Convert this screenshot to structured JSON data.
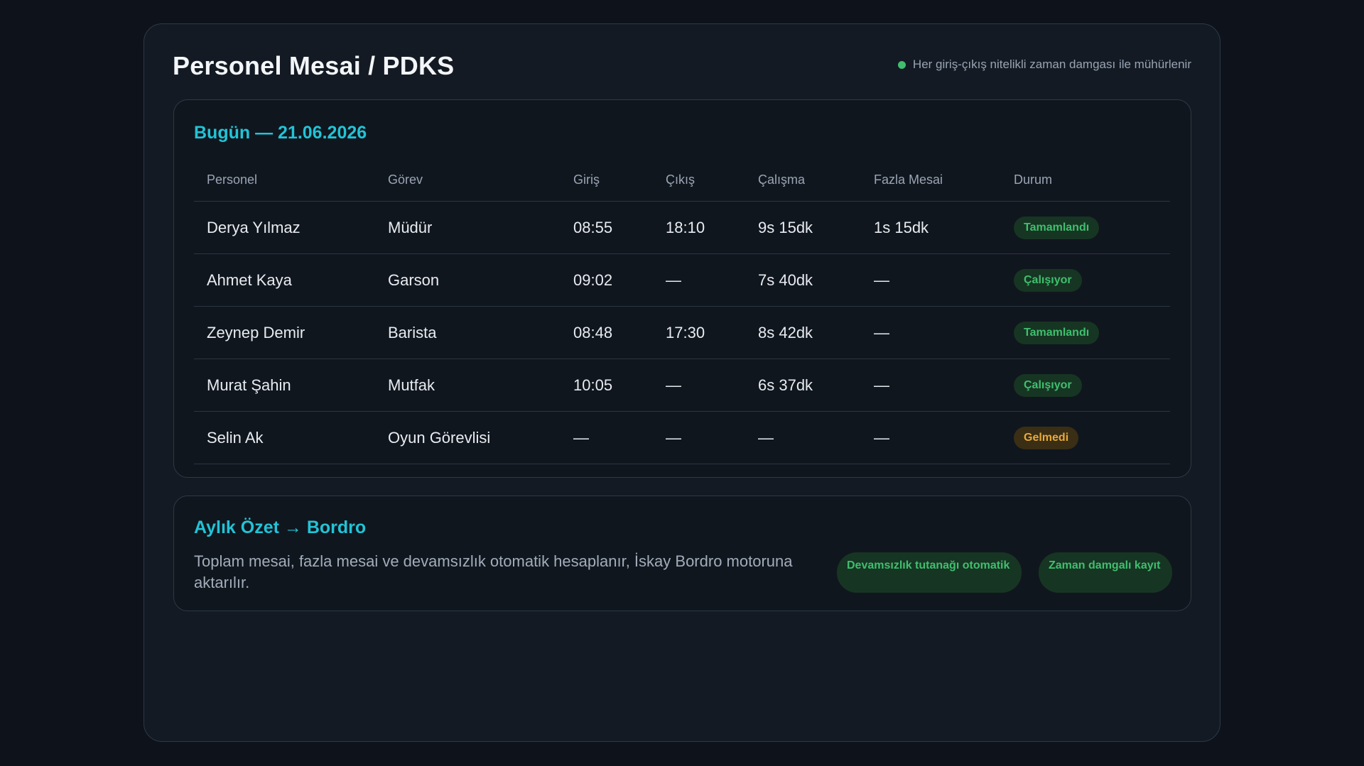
{
  "header": {
    "title": "Personel Mesai / PDKS",
    "seal_note": "Her giriş-çıkış nitelikli zaman damgası ile mühürlenir"
  },
  "today": {
    "title": "Bugün — 21.06.2026",
    "columns": [
      "Personel",
      "Görev",
      "Giriş",
      "Çıkış",
      "Çalışma",
      "Fazla Mesai",
      "Durum"
    ],
    "rows": [
      {
        "name": "Derya Yılmaz",
        "role": "Müdür",
        "in": "08:55",
        "out": "18:10",
        "work": "9s 15dk",
        "overtime": "1s 15dk",
        "status": "Tamamlandı",
        "status_type": "done"
      },
      {
        "name": "Ahmet Kaya",
        "role": "Garson",
        "in": "09:02",
        "out": "—",
        "work": "7s 40dk",
        "overtime": "—",
        "status": "Çalışıyor",
        "status_type": "working"
      },
      {
        "name": "Zeynep Demir",
        "role": "Barista",
        "in": "08:48",
        "out": "17:30",
        "work": "8s 42dk",
        "overtime": "—",
        "status": "Tamamlandı",
        "status_type": "done"
      },
      {
        "name": "Murat Şahin",
        "role": "Mutfak",
        "in": "10:05",
        "out": "—",
        "work": "6s 37dk",
        "overtime": "—",
        "status": "Çalışıyor",
        "status_type": "working"
      },
      {
        "name": "Selin Ak",
        "role": "Oyun Görevlisi",
        "in": "—",
        "out": "—",
        "work": "—",
        "overtime": "—",
        "status": "Gelmedi",
        "status_type": "absent"
      }
    ]
  },
  "summary": {
    "title": "Aylık Özet → Bordro",
    "text": "Toplam mesai, fazla mesai ve devamsızlık otomatik hesaplanır, İskay Bordro motoruna aktarılır.",
    "tags": [
      "Devamsızlık tutanağı otomatik",
      "Zaman damgalı kayıt"
    ]
  },
  "colors": {
    "accent": "#22c3d6",
    "success": "#3fbf6e",
    "warning": "#e8a93a",
    "background": "#0e131b"
  }
}
